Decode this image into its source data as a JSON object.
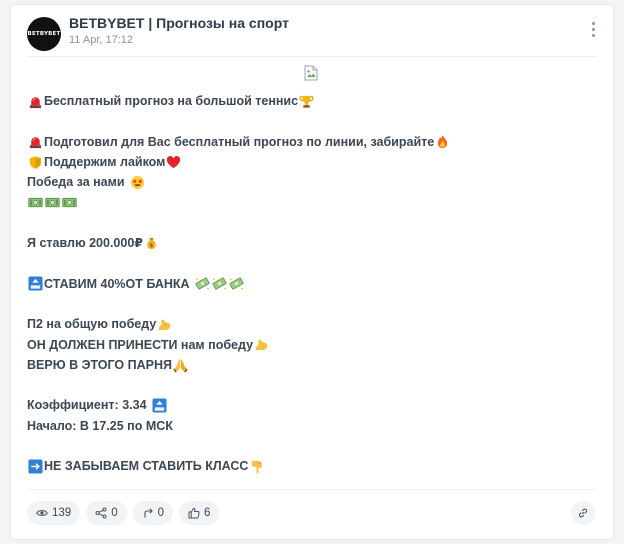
{
  "post": {
    "avatar_text": "BETBYBET",
    "channel_name": "BETBYBET | Прогнозы на спорт",
    "time": "11 Apr, 17:12"
  },
  "body": {
    "l1": "Бесплатный прогноз на большой теннис",
    "l2": "Подготовил для Вас бесплатный прогноз по линии, забирайте",
    "l3": "Поддержим лайком",
    "l4": "Победа за нами",
    "l5": "Я ставлю 200.000₽",
    "l6": "СТАВИМ 40%ОТ БАНКА",
    "l7": "П2 на общую победу",
    "l8": "ОН ДОЛЖЕН ПРИНЕСТИ нам победу",
    "l9": "ВЕРЮ В ЭТОГО ПАРНЯ",
    "l10": "Коэффициент: 3.34",
    "l11": "Начало: В 17.25 по МСК",
    "l12": "НЕ ЗАБЫВАЕМ СТАВИТЬ КЛАСС"
  },
  "stats": {
    "views": "139",
    "shares": "0",
    "reposts": "0",
    "likes": "6"
  },
  "icons": [
    "avatar",
    "more-vertical-icon",
    "broken-image-icon",
    "siren-icon",
    "trophy-icon",
    "fire-icon",
    "shield-icon",
    "red-heart-icon",
    "star-struck-face-icon",
    "money-bills-icon",
    "money-bag-icon",
    "top-arrow-icon",
    "flying-money-icon",
    "flexed-biceps-icon",
    "praying-hands-icon",
    "right-arrow-icon",
    "pointing-down-hand-icon",
    "eye-icon",
    "share-icon",
    "repost-icon",
    "thumbs-up-icon",
    "link-icon"
  ],
  "colors": {
    "text": "#3c4655",
    "muted": "#8b95a3",
    "accent_blue": "#2f7fd9"
  }
}
